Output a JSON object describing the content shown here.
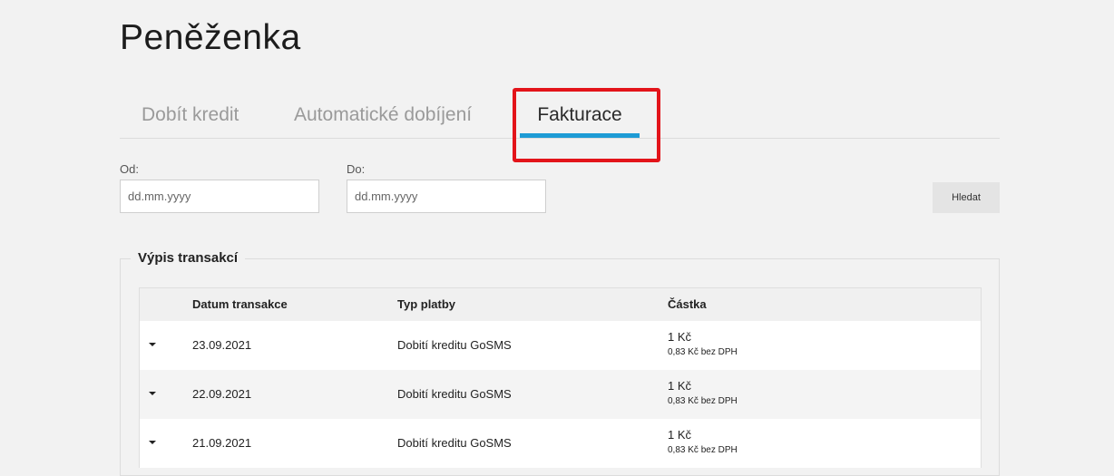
{
  "page": {
    "title": "Peněženka"
  },
  "tabs": [
    {
      "label": "Dobít kredit",
      "active": false
    },
    {
      "label": "Automatické dobíjení",
      "active": false
    },
    {
      "label": "Fakturace",
      "active": true
    }
  ],
  "filters": {
    "from": {
      "label": "Od:",
      "placeholder": "dd.mm.yyyy",
      "value": ""
    },
    "to": {
      "label": "Do:",
      "placeholder": "dd.mm.yyyy",
      "value": ""
    },
    "search_label": "Hledat"
  },
  "transactions": {
    "legend": "Výpis transakcí",
    "columns": [
      "Datum transakce",
      "Typ platby",
      "Částka"
    ],
    "rows": [
      {
        "date": "23.09.2021",
        "type": "Dobití kreditu GoSMS",
        "amount": "1 Kč",
        "amount_net": "0,83 Kč bez DPH"
      },
      {
        "date": "22.09.2021",
        "type": "Dobití kreditu GoSMS",
        "amount": "1 Kč",
        "amount_net": "0,83 Kč bez DPH"
      },
      {
        "date": "21.09.2021",
        "type": "Dobití kreditu GoSMS",
        "amount": "1 Kč",
        "amount_net": "0,83 Kč bez DPH"
      }
    ]
  },
  "colors": {
    "accent": "#1e9bd5",
    "highlight": "#e3141a",
    "background": "#f2f2f2"
  },
  "icons": {
    "row_toggle": "caret-down-icon"
  }
}
